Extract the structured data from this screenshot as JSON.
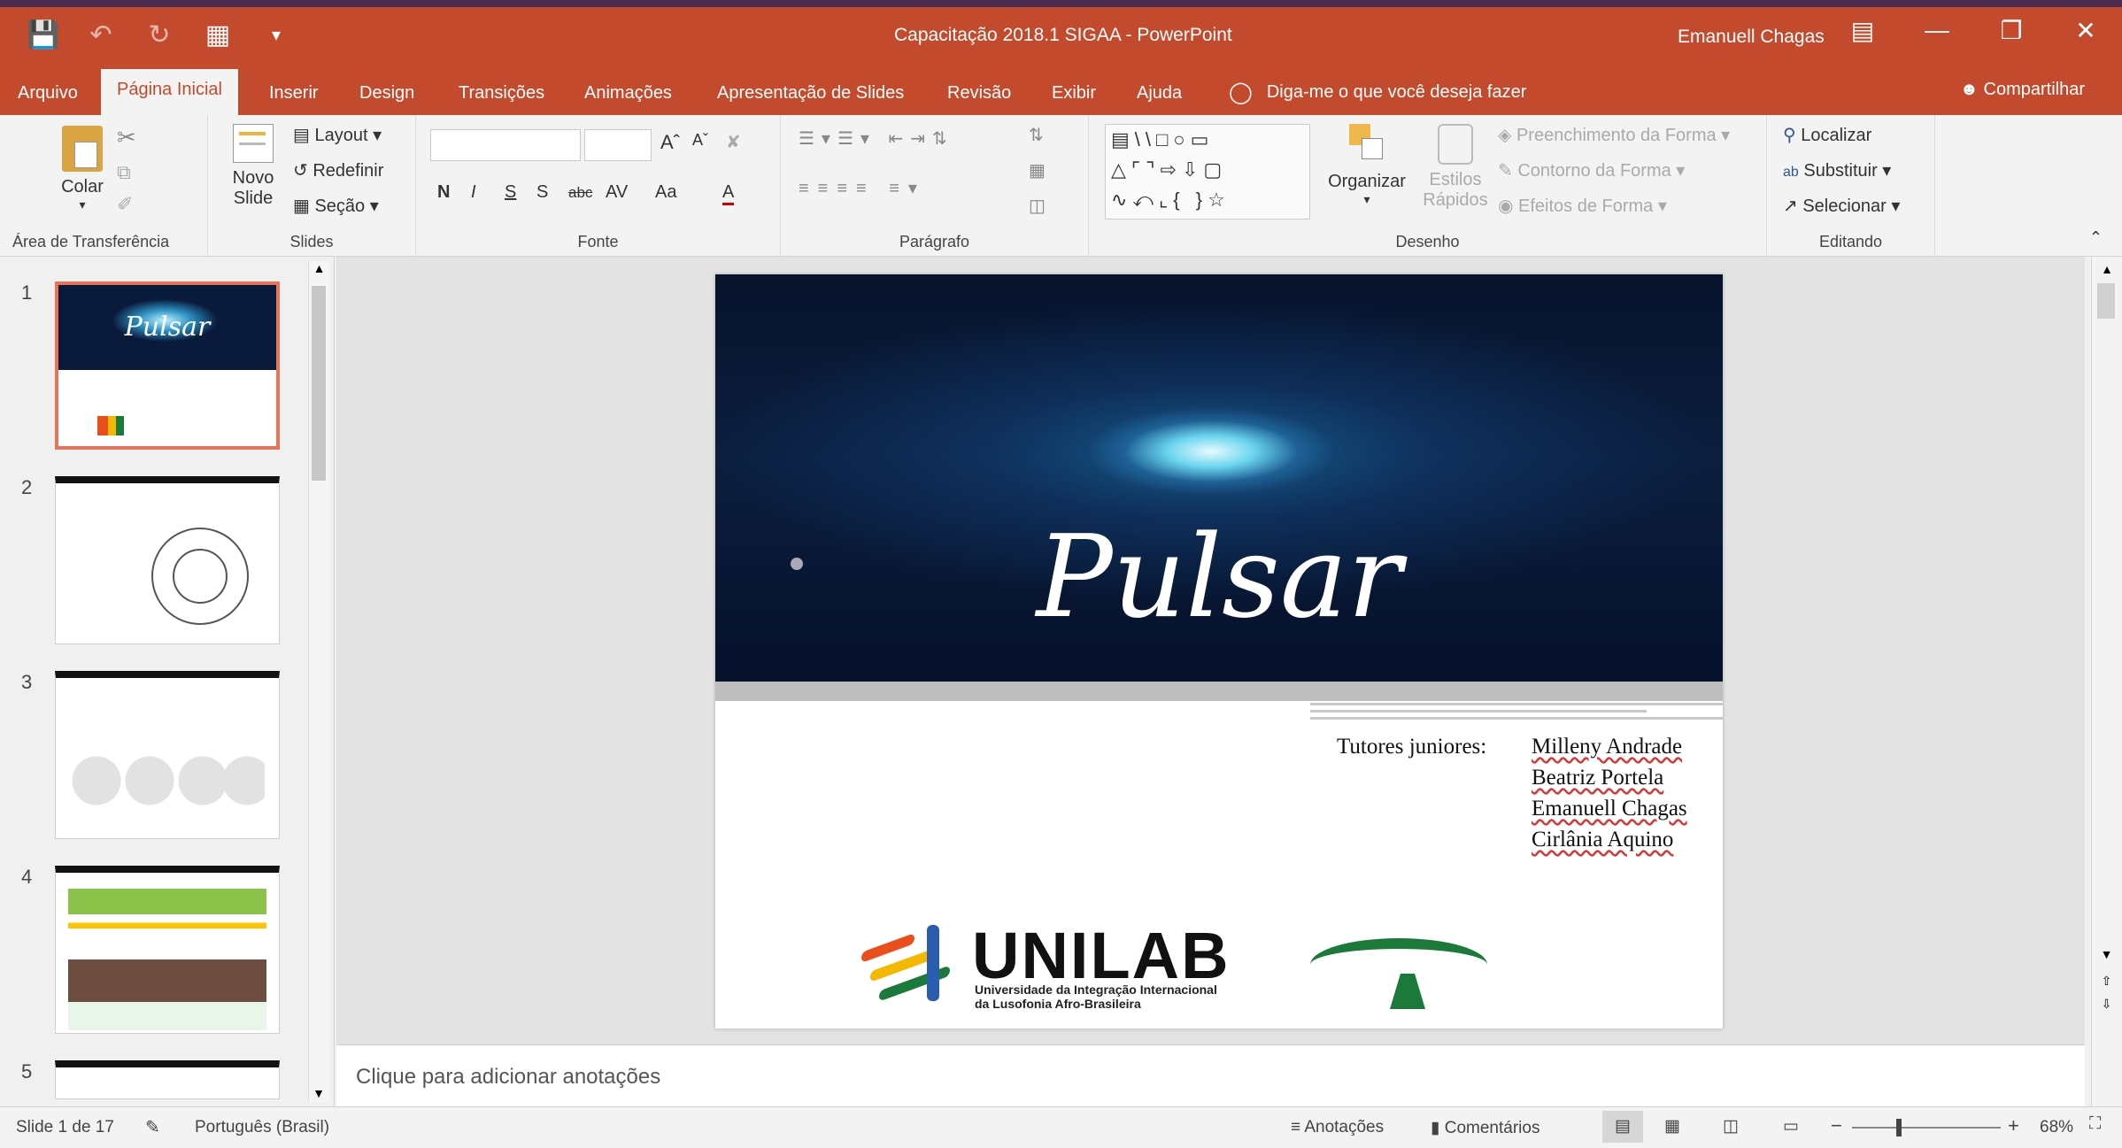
{
  "window": {
    "title": "Capacitação 2018.1 SIGAA  -  PowerPoint",
    "user": "Emanuell Chagas",
    "qat_icons": [
      "save-icon",
      "undo-icon",
      "redo-icon",
      "start-presentation-icon",
      "customize-qat-icon"
    ],
    "controls": [
      "ribbon-display-icon",
      "minimize-icon",
      "restore-icon",
      "close-icon"
    ]
  },
  "tabs": [
    "Arquivo",
    "Página Inicial",
    "Inserir",
    "Design",
    "Transições",
    "Animações",
    "Apresentação de Slides",
    "Revisão",
    "Exibir",
    "Ajuda"
  ],
  "active_tab": "Página Inicial",
  "tell_me": "Diga-me o que você deseja fazer",
  "share": "Compartilhar",
  "ribbon": {
    "clipboard": {
      "label": "Área de Transferência",
      "paste": "Colar"
    },
    "slides": {
      "label": "Slides",
      "new_slide_1": "Novo",
      "new_slide_2": "Slide",
      "layout": "Layout",
      "reset": "Redefinir",
      "section": "Seção"
    },
    "font": {
      "label": "Fonte",
      "bold": "N",
      "italic": "I",
      "underline": "S",
      "shadow": "S",
      "strike": "abc",
      "spacing": "AV",
      "case": "Aa",
      "color": "A"
    },
    "paragraph": {
      "label": "Parágrafo"
    },
    "drawing": {
      "label": "Desenho",
      "arrange": "Organizar",
      "quick_styles_1": "Estilos",
      "quick_styles_2": "Rápidos",
      "shape_fill": "Preenchimento da Forma",
      "shape_outline": "Contorno da Forma",
      "shape_effects": "Efeitos de Forma"
    },
    "editing": {
      "label": "Editando",
      "find": "Localizar",
      "replace": "Substituir",
      "select": "Selecionar"
    }
  },
  "thumbnails": [
    {
      "num": "1",
      "title": "Pulsar"
    },
    {
      "num": "2"
    },
    {
      "num": "3"
    },
    {
      "num": "4"
    },
    {
      "num": "5"
    }
  ],
  "slide": {
    "title": "Pulsar",
    "tutors_label": "Tutores juniores:",
    "tutors": [
      "Milleny Andrade",
      "Beatriz Portela",
      "Emanuell Chagas",
      "Cirlânia Aquino"
    ],
    "logo_word": "UNILAB",
    "logo_sub_1": "Universidade da Integração Internacional",
    "logo_sub_2": "da Lusofonia Afro-Brasileira"
  },
  "notes_placeholder": "Clique para adicionar anotações",
  "status": {
    "slide_count": "Slide 1 de 17",
    "language": "Português (Brasil)",
    "notes": "Anotações",
    "comments": "Comentários",
    "zoom": "68%"
  },
  "colors": {
    "accent": "#c44a2d",
    "selection": "#e8745a"
  }
}
